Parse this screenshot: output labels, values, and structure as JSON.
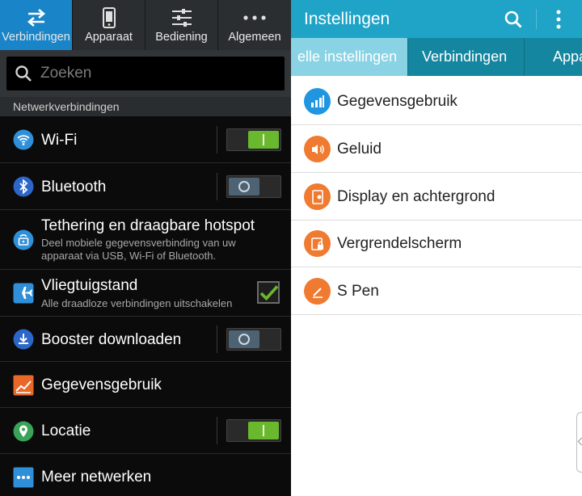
{
  "left": {
    "tabs": [
      {
        "label": "Verbindingen",
        "icon": "connections-arrows-icon",
        "active": true
      },
      {
        "label": "Apparaat",
        "icon": "phone-device-icon",
        "active": false
      },
      {
        "label": "Bediening",
        "icon": "sliders-control-icon",
        "active": false
      },
      {
        "label": "Algemeen",
        "icon": "more-dots-icon",
        "active": false
      }
    ],
    "search": {
      "placeholder": "Zoeken"
    },
    "section_header": "Netwerkverbindingen",
    "rows": [
      {
        "title": "Wi-Fi",
        "icon": "wifi-icon",
        "toggle": "on"
      },
      {
        "title": "Bluetooth",
        "icon": "bluetooth-icon",
        "toggle": "off"
      },
      {
        "title": "Tethering en draagbare hotspot",
        "subtitle": "Deel mobiele gegevensverbinding van uw apparaat via USB, Wi-Fi of Bluetooth.",
        "icon": "hotspot-icon"
      },
      {
        "title": "Vliegtuigstand",
        "subtitle": "Alle draadloze verbindingen uitschakelen",
        "icon": "airplane-icon",
        "checked": true
      },
      {
        "title": "Booster downloaden",
        "icon": "download-booster-icon",
        "toggle": "off"
      },
      {
        "title": "Gegevensgebruik",
        "icon": "data-usage-chart-icon"
      },
      {
        "title": "Locatie",
        "icon": "location-pin-icon",
        "toggle": "on"
      },
      {
        "title": "Meer netwerken",
        "icon": "more-networks-icon"
      }
    ],
    "colors": {
      "active_tab": "#1a84c8",
      "toggle_on": "#6ab82d",
      "toggle_off": "#4d6272"
    }
  },
  "right": {
    "title": "Instellingen",
    "subtabs": [
      {
        "label": "elle instellingen",
        "active": true
      },
      {
        "label": "Verbindingen",
        "active": false
      },
      {
        "label": "Appa",
        "active": false
      }
    ],
    "items": [
      {
        "label": "Gegevensgebruik",
        "icon": "data-bars-icon",
        "color": "#2196e0"
      },
      {
        "label": "Geluid",
        "icon": "speaker-icon",
        "color": "#ef7a30"
      },
      {
        "label": "Display en achtergrond",
        "icon": "display-icon",
        "color": "#ef7a30"
      },
      {
        "label": "Vergrendelscherm",
        "icon": "lockscreen-icon",
        "color": "#ef7a30"
      },
      {
        "label": "S Pen",
        "icon": "pen-icon",
        "color": "#ef7a30"
      }
    ],
    "colors": {
      "appbar": "#1fa3c7",
      "subtabs": "#15869f"
    }
  }
}
